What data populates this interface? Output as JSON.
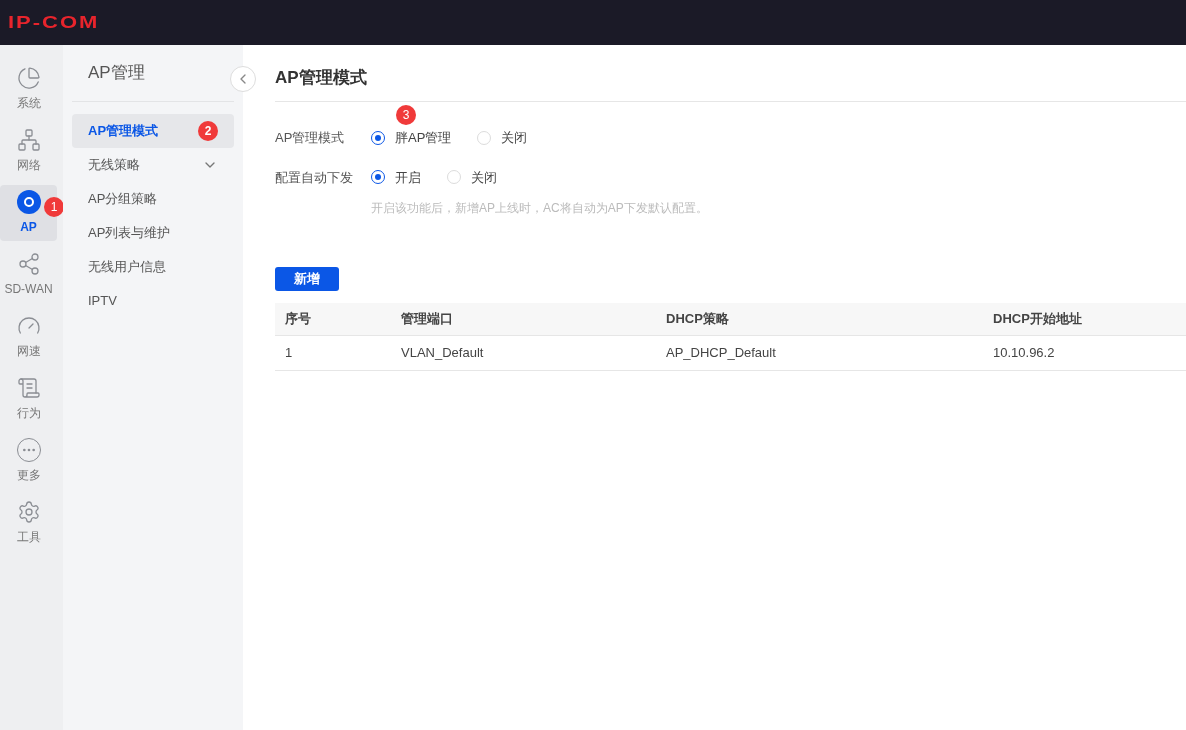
{
  "header": {
    "logo": "IP-COM"
  },
  "rail": [
    {
      "kind": "pie",
      "label": "系统",
      "selected": false
    },
    {
      "kind": "network",
      "label": "网络",
      "selected": false
    },
    {
      "kind": "ap",
      "label": "AP",
      "selected": true,
      "badge": "1"
    },
    {
      "kind": "sdwan",
      "label": "SD-WAN",
      "selected": false
    },
    {
      "kind": "gauge",
      "label": "网速",
      "selected": false
    },
    {
      "kind": "shield",
      "label": "行为",
      "selected": false
    },
    {
      "kind": "more",
      "label": "更多",
      "selected": false
    },
    {
      "kind": "gear",
      "label": "工具",
      "selected": false
    }
  ],
  "submenu": {
    "title": "AP管理",
    "items": [
      {
        "label": "AP管理模式",
        "selected": true,
        "badge": "2"
      },
      {
        "label": "无线策略",
        "selected": false,
        "expandable": true
      },
      {
        "label": "AP分组策略",
        "selected": false
      },
      {
        "label": "AP列表与维护",
        "selected": false
      },
      {
        "label": "无线用户信息",
        "selected": false
      },
      {
        "label": "IPTV",
        "selected": false
      }
    ]
  },
  "main": {
    "title": "AP管理模式",
    "badge": "3",
    "fields": [
      {
        "label": "AP管理模式",
        "options": [
          {
            "label": "胖AP管理",
            "selected": true
          },
          {
            "label": "关闭",
            "selected": false
          }
        ]
      },
      {
        "label": "配置自动下发",
        "options": [
          {
            "label": "开启",
            "selected": true
          },
          {
            "label": "关闭",
            "selected": false
          }
        ],
        "hint": "开启该功能后，新增AP上线时，AC将自动为AP下发默认配置。"
      }
    ],
    "add_button": "新增",
    "table": {
      "columns": [
        "序号",
        "管理端口",
        "DHCP策略",
        "DHCP开始地址"
      ],
      "rows": [
        [
          "1",
          "VLAN_Default",
          "AP_DHCP_Default",
          "10.10.96.2"
        ]
      ]
    }
  }
}
